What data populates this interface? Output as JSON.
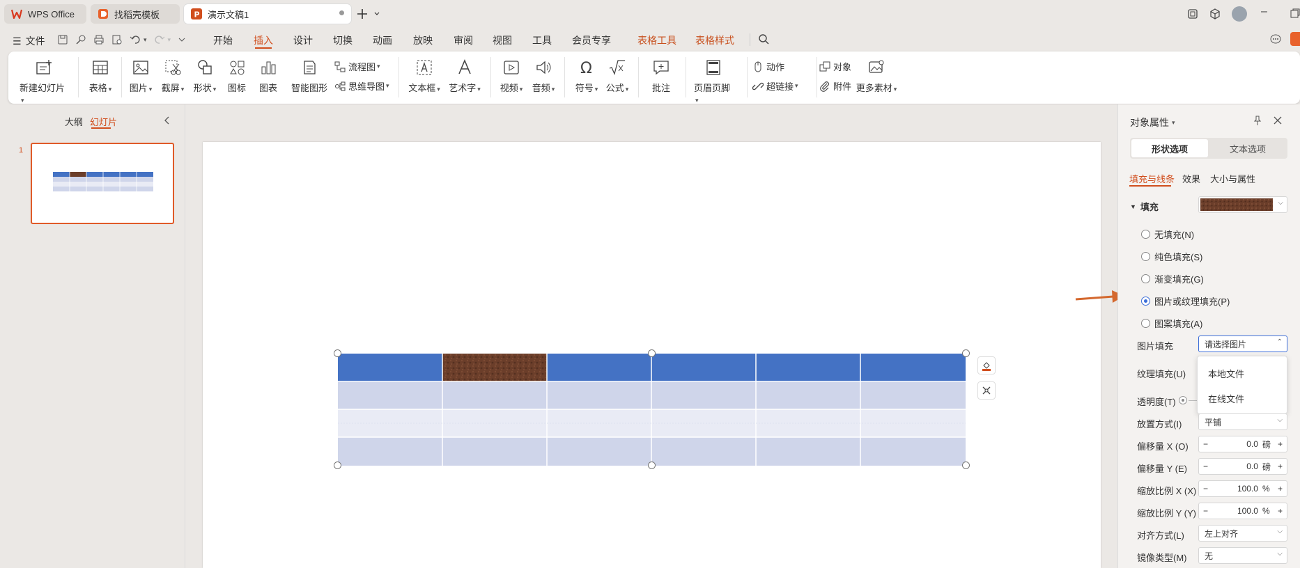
{
  "tabs": [
    {
      "label": "WPS Office"
    },
    {
      "label": "找稻壳模板"
    },
    {
      "label": "演示文稿1"
    }
  ],
  "menu": {
    "file": "文件",
    "items": [
      "开始",
      "插入",
      "设计",
      "切换",
      "动画",
      "放映",
      "审阅",
      "视图",
      "工具",
      "会员专享"
    ],
    "context": [
      "表格工具",
      "表格样式"
    ]
  },
  "ribbon": {
    "new_slide": "新建幻灯片",
    "table": "表格",
    "picture": "图片",
    "screenshot": "截屏",
    "shape": "形状",
    "icon": "图标",
    "chart": "图表",
    "smartart": "智能图形",
    "flowchart": "流程图",
    "mindmap": "思维导图",
    "textbox": "文本框",
    "wordart": "艺术字",
    "video": "视频",
    "audio": "音频",
    "symbol": "符号",
    "formula": "公式",
    "comment": "批注",
    "header_footer": "页眉页脚",
    "action": "动作",
    "hyperlink": "超链接",
    "object": "对象",
    "attachment": "附件",
    "more": "更多素材"
  },
  "left_panel": {
    "tab_outline": "大纲",
    "tab_slides": "幻灯片",
    "slide_number": "1"
  },
  "right_panel": {
    "title": "对象属性",
    "tab_shape": "形状选项",
    "tab_text": "文本选项",
    "sub_fill_line": "填充与线条",
    "sub_effect": "效果",
    "sub_size": "大小与属性",
    "fill_header": "填充",
    "radio_none": "无填充(N)",
    "radio_solid": "纯色填充(S)",
    "radio_gradient": "渐变填充(G)",
    "radio_picture": "图片或纹理填充(P)",
    "radio_pattern": "图案填充(A)",
    "picture_fill_label": "图片填充",
    "picture_fill_value": "请选择图片",
    "texture_fill_label": "纹理填充(U)",
    "transparency_label": "透明度(T)",
    "placement_label": "放置方式(I)",
    "placement_value": "平铺",
    "offset_x_label": "偏移量 X (O)",
    "offset_x_value": "0.0",
    "offset_y_label": "偏移量 Y (E)",
    "offset_y_value": "0.0",
    "scale_x_label": "缩放比例 X (X)",
    "scale_x_value": "100.0",
    "scale_y_label": "缩放比例 Y (Y)",
    "scale_y_value": "100.0",
    "unit_pt": "磅",
    "unit_pct": "%",
    "align_label": "对齐方式(L)",
    "align_value": "左上对齐",
    "mirror_label": "镜像类型(M)",
    "mirror_value": "无",
    "dropdown": [
      "本地文件",
      "在线文件"
    ]
  },
  "colors": {
    "accent": "#d14e1d",
    "header_blue": "#4472c4",
    "row_light": "#cfd5ea",
    "row_lighter": "#e9ebf5",
    "leather": "#6b3e2a"
  }
}
